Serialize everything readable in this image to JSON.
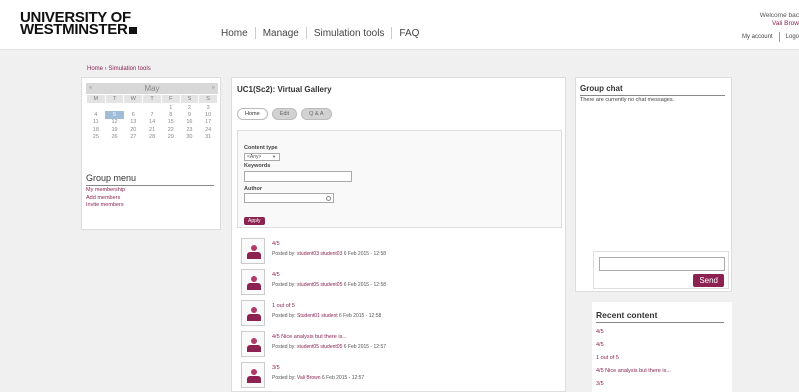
{
  "header": {
    "logo_line1": "UNIVERSITY OF",
    "logo_line2": "WESTMINSTER",
    "nav": [
      "Home",
      "Manage",
      "Simulation tools",
      "FAQ"
    ],
    "welcome": "Welcome bac",
    "user_name": "Vali Brow",
    "my_account": "My account",
    "logout": "Logo"
  },
  "breadcrumb": "Home › Simulation tools",
  "calendar": {
    "month": "May",
    "prev": "«",
    "next": "»",
    "weekdays": [
      "M",
      "T",
      "W",
      "T",
      "F",
      "S",
      "S"
    ],
    "weeks": [
      [
        "",
        "",
        "",
        "",
        "1",
        "2",
        "3"
      ],
      [
        "4",
        "5",
        "6",
        "7",
        "8",
        "9",
        "10"
      ],
      [
        "11",
        "12",
        "13",
        "14",
        "15",
        "16",
        "17"
      ],
      [
        "18",
        "19",
        "20",
        "21",
        "22",
        "23",
        "24"
      ],
      [
        "25",
        "26",
        "27",
        "28",
        "29",
        "30",
        "31"
      ]
    ],
    "today": "5"
  },
  "group_menu": {
    "title": "Group menu",
    "items": [
      "My membership",
      "Add members",
      "Invite members"
    ]
  },
  "gallery": {
    "title": "UC1(Sc2): Virtual Gallery",
    "tabs": [
      "Home",
      "Edit",
      "Q & A"
    ],
    "filter": {
      "content_type_label": "Content type",
      "content_type_value": "<Any>",
      "keywords_label": "Keywords",
      "author_label": "Author",
      "apply_label": "Apply"
    },
    "posts": [
      {
        "title": "4/5",
        "posted_by": "Posted by:",
        "author": "student03 student03",
        "date": "6 Feb 2015 - 12:58"
      },
      {
        "title": "4/5",
        "posted_by": "Posted by:",
        "author": "student05 student05",
        "date": "6 Feb 2015 - 12:58"
      },
      {
        "title": "1 out of 5",
        "posted_by": "Posted by:",
        "author": "Student01 student",
        "date": "6 Feb 2015 - 12:58"
      },
      {
        "title": "4/5 Nice analysis but there is...",
        "posted_by": "Posted by:",
        "author": "student05 student05",
        "date": "6 Feb 2015 - 12:57"
      },
      {
        "title": "3/5",
        "posted_by": "Posted by:",
        "author": "Vali Brown",
        "date": "6 Feb 2015 - 12:57"
      }
    ]
  },
  "group_chat": {
    "title": "Group chat",
    "empty_text": "There are currently no chat messages.",
    "send_label": "Send"
  },
  "recent_content": {
    "title": "Recent content",
    "items": [
      "4/5",
      "4/5",
      "1 out of 5",
      "4/5 Nice analysis but there is...",
      "3/5"
    ]
  },
  "colors": {
    "accent": "#8b2252",
    "calendar_today": "#9fbcd8"
  }
}
